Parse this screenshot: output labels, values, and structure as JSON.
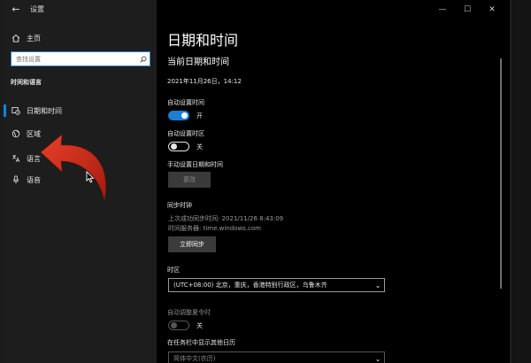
{
  "window": {
    "title": "设置",
    "controls": {
      "minimize": "—",
      "maximize": "☐",
      "close": "✕"
    }
  },
  "sidebar": {
    "home_label": "主页",
    "search_placeholder": "查找设置",
    "section_heading": "时间和语言",
    "items": [
      {
        "label": "日期和时间",
        "icon": "calendar-clock-icon",
        "selected": true
      },
      {
        "label": "区域",
        "icon": "globe-icon",
        "selected": false
      },
      {
        "label": "语言",
        "icon": "language-icon",
        "selected": false
      },
      {
        "label": "语音",
        "icon": "microphone-icon",
        "selected": false
      }
    ]
  },
  "main": {
    "page_title": "日期和时间",
    "subtitle": "当前日期和时间",
    "current_datetime": "2021年11月26日，14:12",
    "auto_time": {
      "label": "自动设置时间",
      "state": "开",
      "on": true
    },
    "auto_timezone": {
      "label": "自动设置时区",
      "state": "关",
      "on": false
    },
    "manual": {
      "label": "手动设置日期和时间",
      "button": "更改"
    },
    "sync": {
      "heading": "同步时钟",
      "last_sync": "上次成功同步时间: 2021/11/26 8:43:09",
      "server": "时间服务器: time.windows.com",
      "button": "立即同步"
    },
    "timezone": {
      "label": "时区",
      "value": "(UTC+08:00) 北京，重庆，香港特别行政区，乌鲁木齐"
    },
    "dst": {
      "label": "自动调整夏令时",
      "state": "关",
      "on": false,
      "disabled": true
    },
    "calendar": {
      "label": "在任务栏中显示其他日历",
      "value": "简体中文(农历)"
    }
  },
  "colors": {
    "accent": "#1b7fd3",
    "sidebar_bg": "#1d1d1d",
    "content_bg": "#000000",
    "annotation_arrow": "#d12a1a"
  }
}
